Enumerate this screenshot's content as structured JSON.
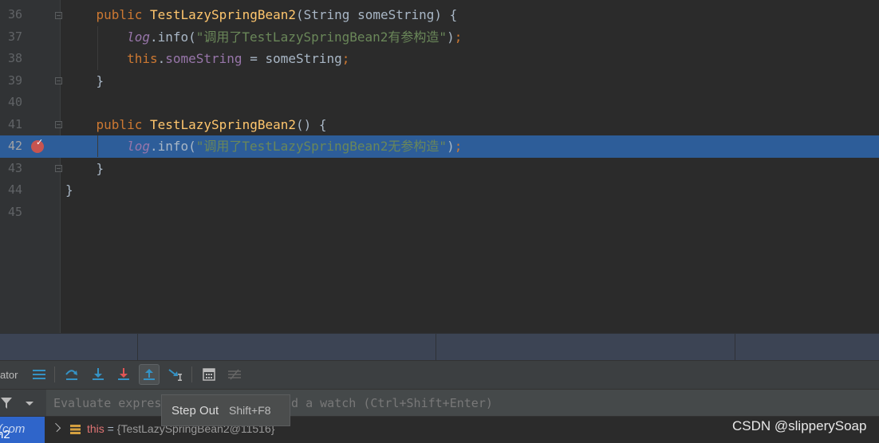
{
  "editor": {
    "lines": [
      {
        "num": "36",
        "indent": "    ",
        "tokens": [
          [
            "kw",
            "public "
          ],
          [
            "fn",
            "TestLazySpringBean2"
          ],
          [
            "ty",
            "(String someString) {"
          ]
        ]
      },
      {
        "num": "37",
        "indent": "        ",
        "tokens": [
          [
            "log",
            "log"
          ],
          [
            "ty",
            ".info("
          ],
          [
            "str",
            "\"调用了TestLazySpringBean2有参构造\""
          ],
          [
            "ty",
            ")"
          ],
          [
            "kw",
            ";"
          ]
        ]
      },
      {
        "num": "38",
        "indent": "        ",
        "tokens": [
          [
            "kw",
            "this"
          ],
          [
            "ty",
            "."
          ],
          [
            "fld",
            "someString"
          ],
          [
            "ty",
            " = someString"
          ],
          [
            "kw",
            ";"
          ]
        ]
      },
      {
        "num": "39",
        "indent": "    ",
        "tokens": [
          [
            "ty",
            "}"
          ]
        ]
      },
      {
        "num": "40",
        "indent": "",
        "tokens": []
      },
      {
        "num": "41",
        "indent": "    ",
        "tokens": [
          [
            "kw",
            "public "
          ],
          [
            "fn",
            "TestLazySpringBean2"
          ],
          [
            "ty",
            "() {"
          ]
        ]
      },
      {
        "num": "42",
        "indent": "        ",
        "tokens": [
          [
            "log",
            "log"
          ],
          [
            "ty",
            ".info("
          ],
          [
            "str",
            "\"调用了TestLazySpringBean2无参构造\""
          ],
          [
            "ty",
            ")"
          ],
          [
            "kw",
            ";"
          ]
        ],
        "highlighted": true
      },
      {
        "num": "43",
        "indent": "    ",
        "tokens": [
          [
            "ty",
            "}"
          ]
        ]
      },
      {
        "num": "44",
        "indent": "",
        "tokens": [
          [
            "ty",
            "}"
          ]
        ]
      },
      {
        "num": "45",
        "indent": "",
        "tokens": []
      }
    ]
  },
  "debugger": {
    "panel_label": "ator",
    "eval_placeholder": "Evaluate expres                  d a watch (Ctrl+Shift+Enter)",
    "frame_label": "n2",
    "frame_suffix": "(com",
    "var_name": "this",
    "var_eq": " = ",
    "var_value": "{TestLazySpringBean2@11516}"
  },
  "tooltip": {
    "title": "Step Out",
    "shortcut": "Shift+F8"
  },
  "watermark": "CSDN @slipperySoap",
  "colors": {
    "highlight": "#2d5d99",
    "keyword": "#cc7832",
    "function": "#ffc66d",
    "string": "#6a8759",
    "field": "#9876aa"
  }
}
